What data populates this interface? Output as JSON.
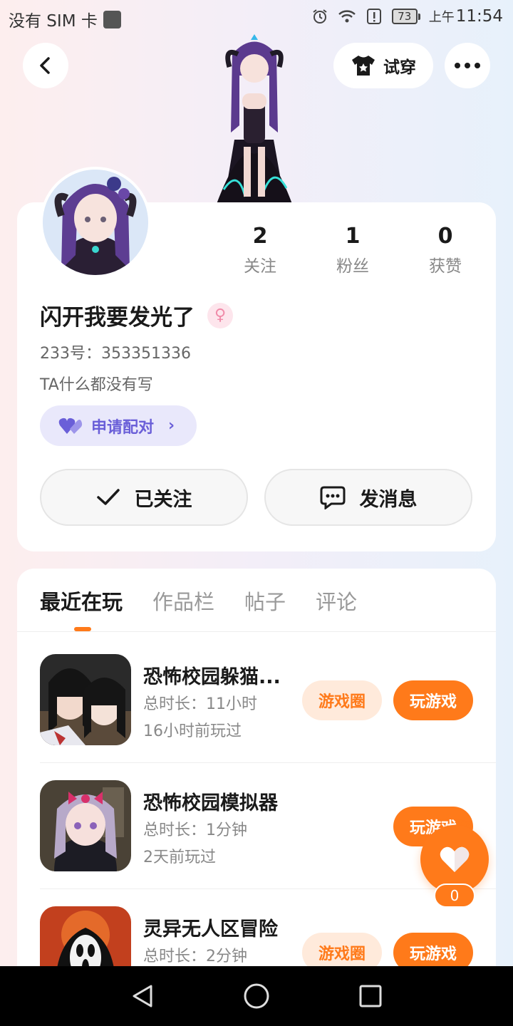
{
  "status_bar": {
    "carrier": "没有 SIM 卡",
    "battery": "73",
    "time_period": "上午",
    "time": "11:54"
  },
  "header": {
    "tryon_label": "试穿"
  },
  "profile": {
    "stats": [
      {
        "num": "2",
        "label": "关注"
      },
      {
        "num": "1",
        "label": "粉丝"
      },
      {
        "num": "0",
        "label": "获赞"
      }
    ],
    "username": "闪开我要发光了",
    "uid": "233号：353351336",
    "bio": "TA什么都没有写",
    "pair_label": "申请配对",
    "follow_label": "已关注",
    "message_label": "发消息"
  },
  "tabs": [
    {
      "label": "最近在玩"
    },
    {
      "label": "作品栏"
    },
    {
      "label": "帖子"
    },
    {
      "label": "评论"
    }
  ],
  "games": [
    {
      "name": "恐怖校园躲猫...",
      "duration": "总时长：11小时",
      "last_played": "16小时前玩过",
      "circle_label": "游戏圈",
      "play_label": "玩游戏"
    },
    {
      "name": "恐怖校园模拟器",
      "duration": "总时长：1分钟",
      "last_played": "2天前玩过",
      "play_label": "玩游戏"
    },
    {
      "name": "灵异无人区冒险",
      "duration": "总时长：2分钟",
      "circle_label": "游戏圈",
      "play_label": "玩游戏"
    }
  ],
  "like": {
    "count": "0"
  },
  "colors": {
    "accent": "#ff7a1a",
    "pair_purple": "#6a5fd8"
  }
}
